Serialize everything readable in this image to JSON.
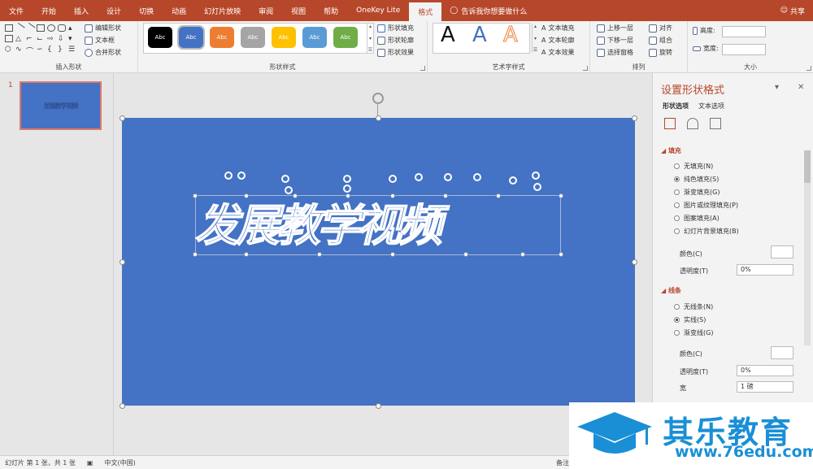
{
  "tabs": [
    "文件",
    "开始",
    "插入",
    "设计",
    "切换",
    "动画",
    "幻灯片放映",
    "审阅",
    "视图",
    "帮助",
    "OneKey Lite",
    "格式"
  ],
  "tell_me": "告诉我你想要做什么",
  "share": "共享",
  "ribbon": {
    "insert_shapes": {
      "edit_shape": "编辑形状",
      "text_box": "文本框",
      "merge_shapes": "合并形状",
      "label": "插入形状"
    },
    "shape_styles": {
      "style_text": "Abc",
      "shape_fill": "形状填充",
      "shape_outline": "形状轮廓",
      "shape_effects": "形状效果",
      "label": "形状样式"
    },
    "wordart": {
      "sample": "A",
      "text_fill": "文本填充",
      "text_outline": "文本轮廓",
      "text_effects": "文本效果",
      "label": "艺术字样式"
    },
    "arrange": {
      "bring_forward": "上移一层",
      "send_backward": "下移一层",
      "selection_pane": "选择窗格",
      "align": "对齐",
      "group": "组合",
      "rotate": "旋转",
      "label": "排列"
    },
    "size": {
      "height": "高度:",
      "width": "宽度:",
      "label": "大小"
    }
  },
  "style_colors": [
    "#000000",
    "#4472c4",
    "#ed7d31",
    "#a5a5a5",
    "#ffc000",
    "#5b9bd5",
    "#70ad47"
  ],
  "thumbnail": {
    "number": "1",
    "text": "发展教学视频"
  },
  "slide": {
    "title": "发展教学视频"
  },
  "pane": {
    "title": "设置形状格式",
    "tab_shape": "形状选项",
    "tab_text": "文本选项",
    "fill_header": "填充",
    "fill_options": [
      "无填充(N)",
      "纯色填充(S)",
      "渐变填充(G)",
      "图片或纹理填充(P)",
      "图案填充(A)",
      "幻灯片背景填充(B)"
    ],
    "color_label": "颜色(C)",
    "transparency_label": "透明度(T)",
    "transparency_value": "0%",
    "line_header": "线条",
    "line_options": [
      "无线条(N)",
      "实线(S)",
      "渐变线(G)"
    ],
    "line_color_label": "颜色(C)",
    "line_transparency_label": "透明度(T)",
    "line_transparency_value": "0%",
    "width_label": "宽",
    "width_value": "1 磅"
  },
  "status": {
    "slide_info": "幻灯片 第 1 张，共 1 张",
    "language": "中文(中国)",
    "notes": "备注"
  },
  "watermark": {
    "name": "其乐教育",
    "url": "www.76edu.com"
  }
}
